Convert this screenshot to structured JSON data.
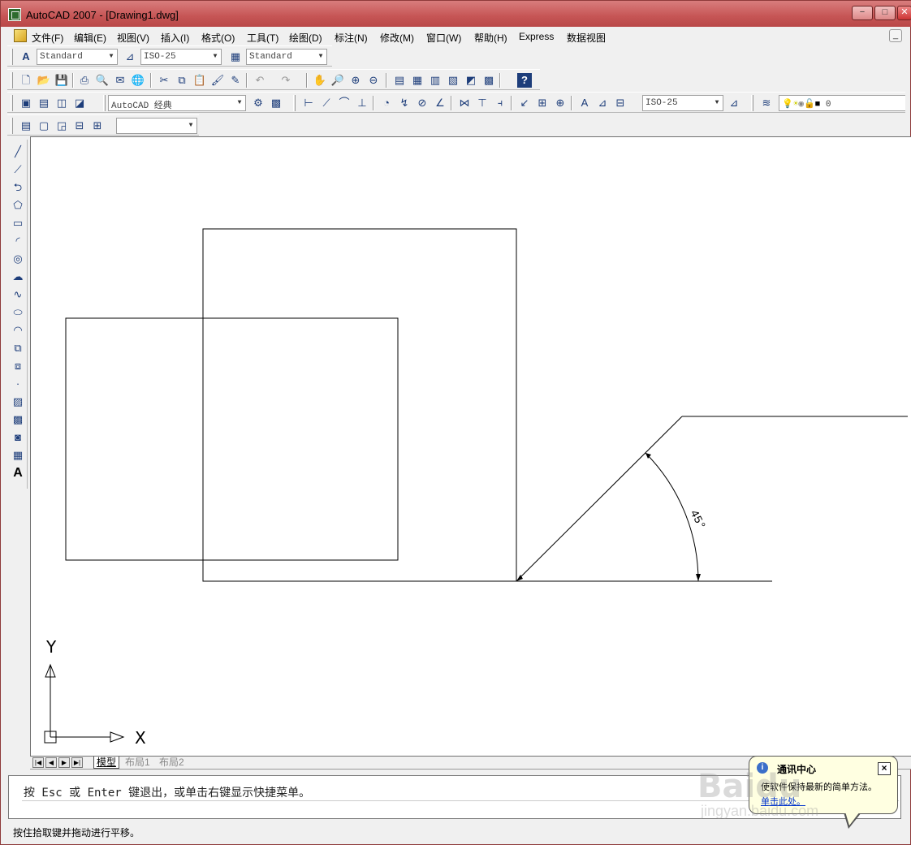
{
  "window": {
    "title": "AutoCAD 2007 - [Drawing1.dwg]",
    "minimize": "−",
    "restore": "□",
    "close": "✕"
  },
  "menu": {
    "items": [
      "文件(F)",
      "编辑(E)",
      "视图(V)",
      "插入(I)",
      "格式(O)",
      "工具(T)",
      "绘图(D)",
      "标注(N)",
      "修改(M)",
      "窗口(W)",
      "帮助(H)",
      "Express",
      "数据视图"
    ]
  },
  "toolbar_styles": {
    "text_style": "Standard",
    "dim_style": "ISO-25",
    "table_style": "Standard"
  },
  "toolbar_workspace": {
    "workspace": "AutoCAD 经典",
    "dim_style": "ISO-25",
    "layer_name": "0"
  },
  "drawing": {
    "angle_label": "45°",
    "ucs_x": "X",
    "ucs_y": "Y"
  },
  "tabs": {
    "model": "模型",
    "layout1": "布局1",
    "layout2": "布局2"
  },
  "command": {
    "line": "按 Esc 或 Enter 键退出，或单击右键显示快捷菜单。"
  },
  "status": {
    "text": "按住拾取键并拖动进行平移。"
  },
  "balloon": {
    "title": "通讯中心",
    "body": "使软件保持最新的简单方法。",
    "link": "单击此处。",
    "close": "×"
  },
  "watermark": {
    "main": "Baidu",
    "sub": "jingyan.baidu.com"
  }
}
